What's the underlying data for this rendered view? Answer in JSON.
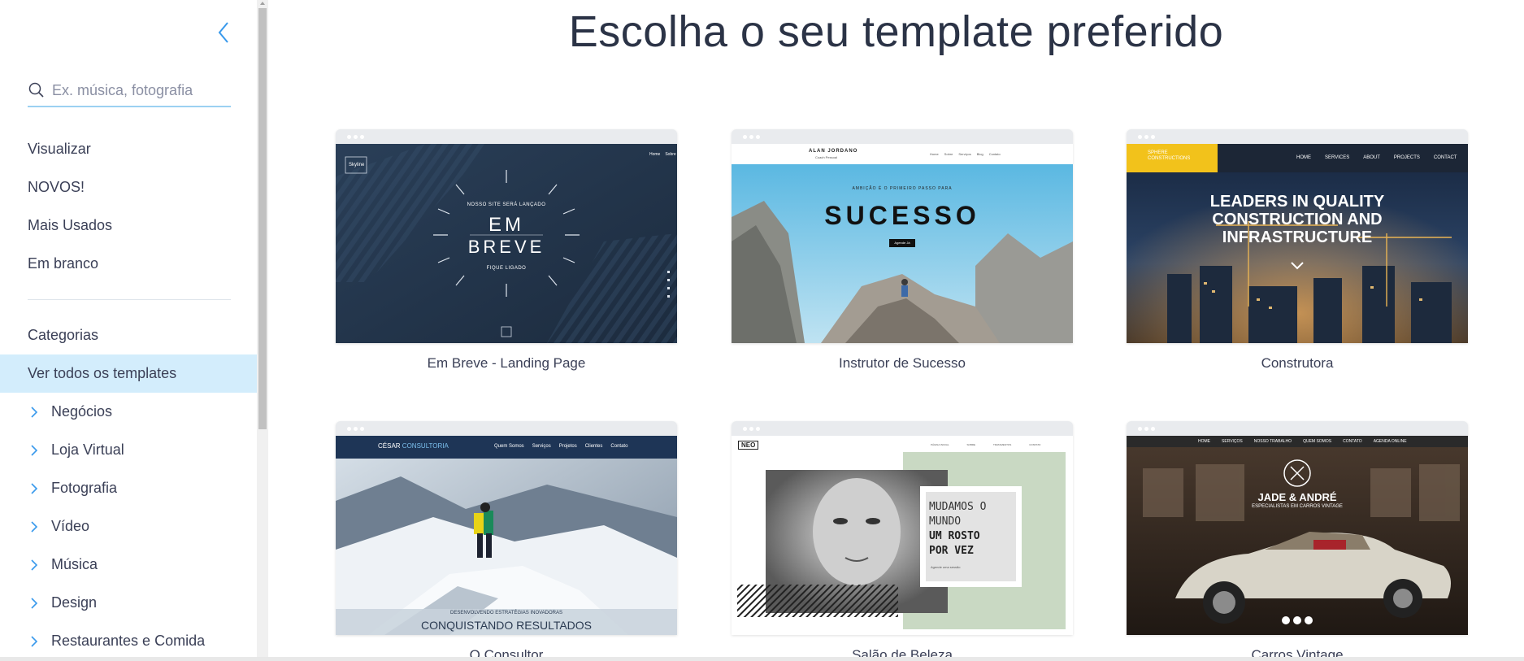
{
  "sidebar": {
    "search_placeholder": "Ex. música, fotografia",
    "top_items": [
      {
        "label": "Visualizar"
      },
      {
        "label": "NOVOS!"
      },
      {
        "label": "Mais Usados"
      },
      {
        "label": "Em branco"
      }
    ],
    "categories_title": "Categorias",
    "categories": [
      {
        "label": "Ver todos os templates",
        "active": true
      },
      {
        "label": "Negócios"
      },
      {
        "label": "Loja Virtual"
      },
      {
        "label": "Fotografia"
      },
      {
        "label": "Vídeo"
      },
      {
        "label": "Música"
      },
      {
        "label": "Design"
      },
      {
        "label": "Restaurantes e Comida"
      }
    ]
  },
  "main": {
    "title": "Escolha o seu template preferido",
    "templates": [
      {
        "caption": "Em Breve - Landing Page",
        "preview": {
          "logo": "Skyline",
          "nav": [
            "Home",
            "Sobre"
          ],
          "kicker": "NOSSO SITE SERÁ LANÇADO",
          "headline_1": "EM",
          "headline_2": "BREVE",
          "sub": "FIQUE LIGADO"
        }
      },
      {
        "caption": "Instrutor de Sucesso",
        "preview": {
          "name": "ALAN JORDANO",
          "role": "Coach Pessoal",
          "nav": [
            "Home",
            "Sobre",
            "Serviços",
            "Blog",
            "Contato"
          ],
          "kicker": "AMBIÇÃO É O PRIMEIRO PASSO PARA",
          "headline": "SUCESSO",
          "cta": "Agende Já"
        }
      },
      {
        "caption": "Construtora",
        "preview": {
          "logo": "SPHERE CONSTRUCTIONS",
          "nav": [
            "HOME",
            "SERVICES",
            "ABOUT",
            "PROJECTS",
            "CONTACT"
          ],
          "headline_1": "LEADERS IN QUALITY",
          "headline_2": "CONSTRUCTION AND",
          "headline_3": "INFRASTRUCTURE"
        }
      },
      {
        "caption": "O Consultor",
        "preview": {
          "logo_a": "CÉSAR",
          "logo_b": "CONSULTORIA",
          "nav": [
            "Quem Somos",
            "Serviços",
            "Projetos",
            "Clientes",
            "Contato"
          ],
          "kicker": "DESENVOLVENDO ESTRATÉGIAS INOVADORAS",
          "headline": "CONQUISTANDO RESULTADOS"
        }
      },
      {
        "caption": "Salão de Beleza",
        "preview": {
          "logo": "NEO",
          "nav": [
            "PÁGINA INICIAL",
            "SOBRE",
            "TRATAMENTOS",
            "CONTATO"
          ],
          "line_1": "MUDAMOS O",
          "line_2": "MUNDO",
          "line_3": "UM ROSTO",
          "line_4": "POR VEZ",
          "cta": "Agende uma sessão"
        }
      },
      {
        "caption": "Carros Vintage",
        "preview": {
          "nav": [
            "HOME",
            "SERVIÇOS",
            "NOSSO TRABALHO",
            "QUEM SOMOS",
            "CONTATO",
            "AGENDA ONLINE"
          ],
          "headline": "JADE & ANDRÉ",
          "sub": "ESPECIALISTAS EM CARROS VINTAGE"
        }
      }
    ]
  },
  "colors": {
    "accent": "#3899ec",
    "active_bg": "#d3edfc",
    "text": "#3b4057"
  }
}
